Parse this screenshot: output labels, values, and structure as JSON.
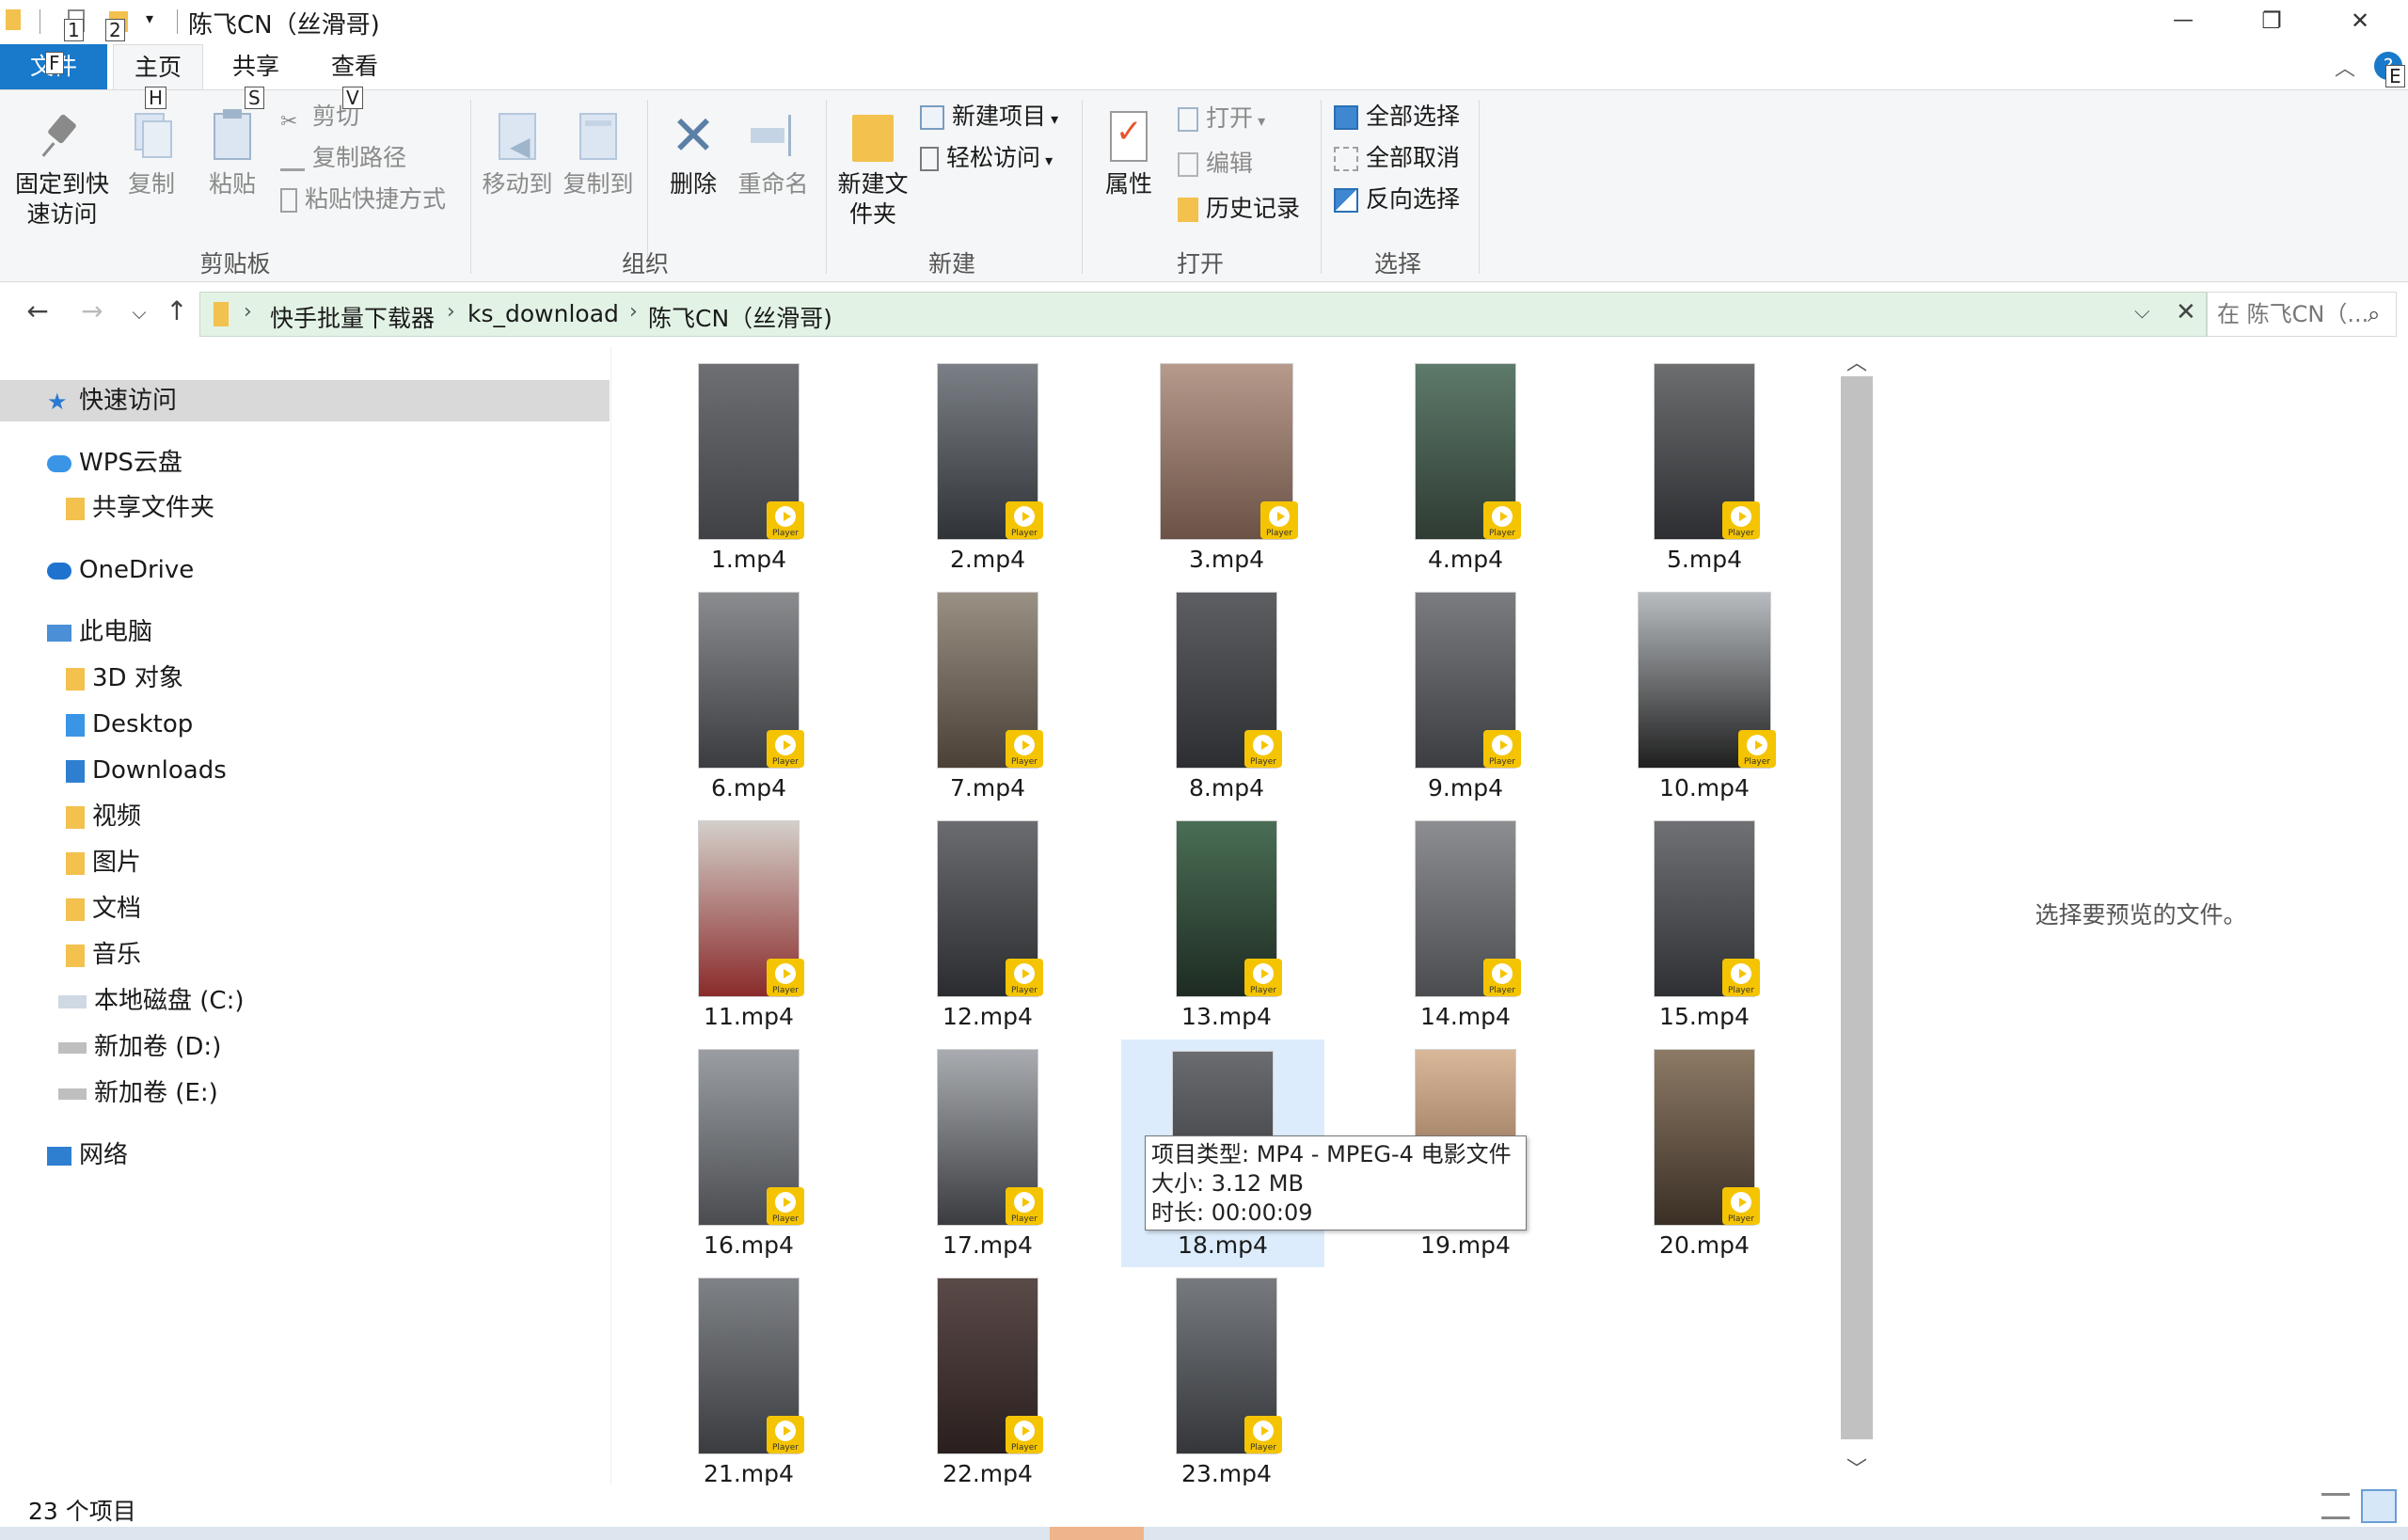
{
  "titlebar": {
    "title": "陈飞CN（丝滑哥)",
    "keytip_1": "1",
    "keytip_2": "2",
    "minimize": "—",
    "restore": "❐",
    "close": "✕"
  },
  "tabs": {
    "file": "文件",
    "home": "主页",
    "share": "共享",
    "view": "查看",
    "keytip_file": "F",
    "keytip_home": "H",
    "keytip_share": "S",
    "keytip_view": "V",
    "keytip_help": "E",
    "help": "?"
  },
  "ribbon": {
    "clipboard": {
      "pin": "固定到快速访问",
      "copy": "复制",
      "paste": "粘贴",
      "cut": "剪切",
      "copy_path": "复制路径",
      "paste_shortcut": "粘贴快捷方式",
      "group": "剪贴板"
    },
    "organize": {
      "move_to": "移动到",
      "copy_to": "复制到",
      "delete": "删除",
      "rename": "重命名",
      "group": "组织"
    },
    "new": {
      "new_folder": "新建文件夹",
      "new_item": "新建项目",
      "easy_access": "轻松访问",
      "group": "新建"
    },
    "open": {
      "properties": "属性",
      "open": "打开",
      "edit": "编辑",
      "history": "历史记录",
      "group": "打开"
    },
    "select": {
      "select_all": "全部选择",
      "select_none": "全部取消",
      "invert": "反向选择",
      "group": "选择"
    }
  },
  "address": {
    "crumbs": [
      "快手批量下载器",
      "ks_download",
      "陈飞CN（丝滑哥)"
    ],
    "search_placeholder": "在 陈飞CN（..."
  },
  "sidebar": {
    "quick_access": "快速访问",
    "wps": "WPS云盘",
    "shared_folder": "共享文件夹",
    "onedrive": "OneDrive",
    "this_pc": "此电脑",
    "objects3d": "3D 对象",
    "desktop": "Desktop",
    "downloads": "Downloads",
    "videos": "视频",
    "pictures": "图片",
    "documents": "文档",
    "music": "音乐",
    "drive_c": "本地磁盘 (C:)",
    "drive_d": "新加卷 (D:)",
    "drive_e": "新加卷 (E:)",
    "network": "网络"
  },
  "files": [
    "1.mp4",
    "2.mp4",
    "3.mp4",
    "4.mp4",
    "5.mp4",
    "6.mp4",
    "7.mp4",
    "8.mp4",
    "9.mp4",
    "10.mp4",
    "11.mp4",
    "12.mp4",
    "13.mp4",
    "14.mp4",
    "15.mp4",
    "16.mp4",
    "17.mp4",
    "18.mp4",
    "19.mp4",
    "20.mp4",
    "21.mp4",
    "22.mp4",
    "23.mp4"
  ],
  "tooltip": {
    "type": "项目类型: MP4 - MPEG-4 电影文件",
    "size": "大小: 3.12 MB",
    "duration": "时长: 00:00:09"
  },
  "preview": {
    "message": "选择要预览的文件。"
  },
  "status": {
    "count": "23 个项目"
  },
  "colors": {
    "file_tab": "#1979ca",
    "address_bg": "#e2f3e5",
    "selection": "#dcecfc",
    "play_badge": "#f5c400"
  }
}
